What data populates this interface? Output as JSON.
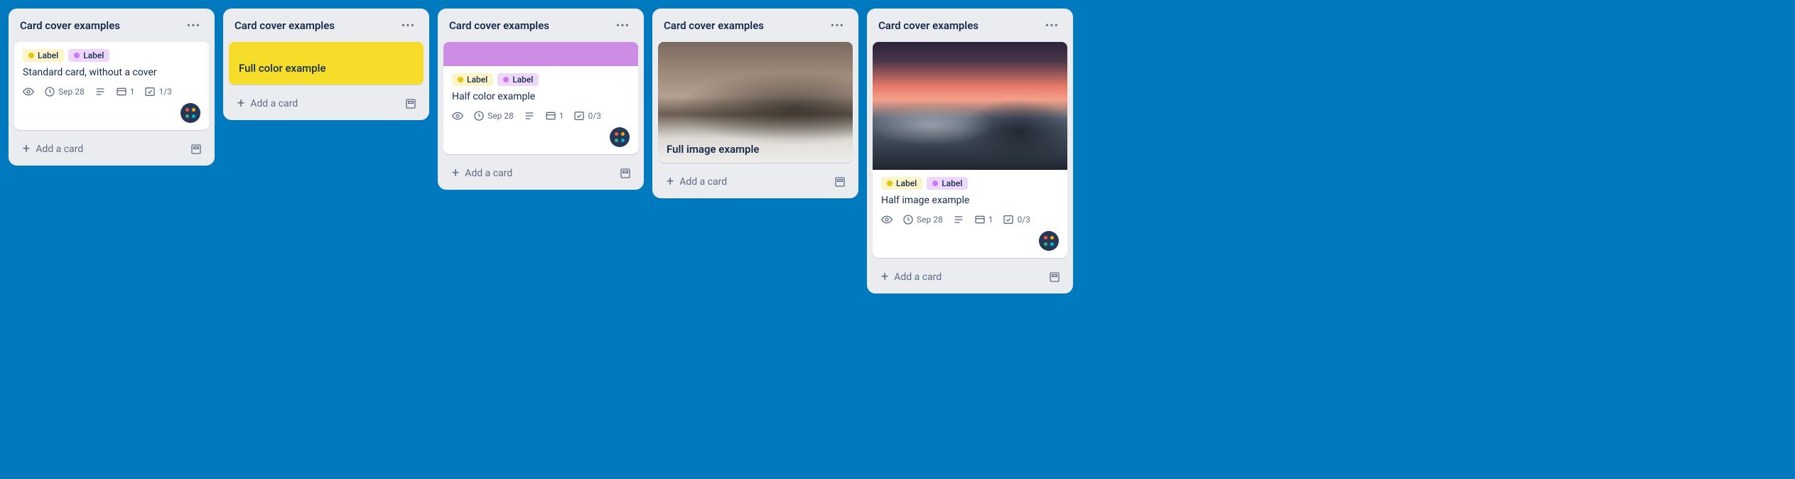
{
  "lists": [
    {
      "title": "Card cover examples",
      "addCardLabel": "Add a card",
      "cards": [
        {
          "type": "standard",
          "labels": [
            {
              "colorClass": "label-yellow",
              "text": "Label"
            },
            {
              "colorClass": "label-purple",
              "text": "Label"
            }
          ],
          "title": "Standard card, without a cover",
          "badges": {
            "watch": true,
            "due": "Sep 28",
            "desc": true,
            "attach": "1",
            "check": "1/3"
          },
          "hasMember": true
        }
      ]
    },
    {
      "title": "Card cover examples",
      "addCardLabel": "Add a card",
      "cards": [
        {
          "type": "full-color",
          "title": "Full color example"
        }
      ]
    },
    {
      "title": "Card cover examples",
      "addCardLabel": "Add a card",
      "cards": [
        {
          "type": "half-color",
          "labels": [
            {
              "colorClass": "label-yellow",
              "text": "Label"
            },
            {
              "colorClass": "label-purple",
              "text": "Label"
            }
          ],
          "title": "Half color example",
          "badges": {
            "watch": true,
            "due": "Sep 28",
            "desc": true,
            "attach": "1",
            "check": "0/3"
          },
          "hasMember": true
        }
      ]
    },
    {
      "title": "Card cover examples",
      "addCardLabel": "Add a card",
      "cards": [
        {
          "type": "full-image",
          "title": "Full image example"
        }
      ]
    },
    {
      "title": "Card cover examples",
      "addCardLabel": "Add a card",
      "cards": [
        {
          "type": "half-image",
          "labels": [
            {
              "colorClass": "label-yellow",
              "text": "Label"
            },
            {
              "colorClass": "label-purple",
              "text": "Label"
            }
          ],
          "title": "Half image example",
          "badges": {
            "watch": true,
            "due": "Sep 28",
            "desc": true,
            "attach": "1",
            "check": "0/3"
          },
          "hasMember": true
        }
      ]
    }
  ]
}
